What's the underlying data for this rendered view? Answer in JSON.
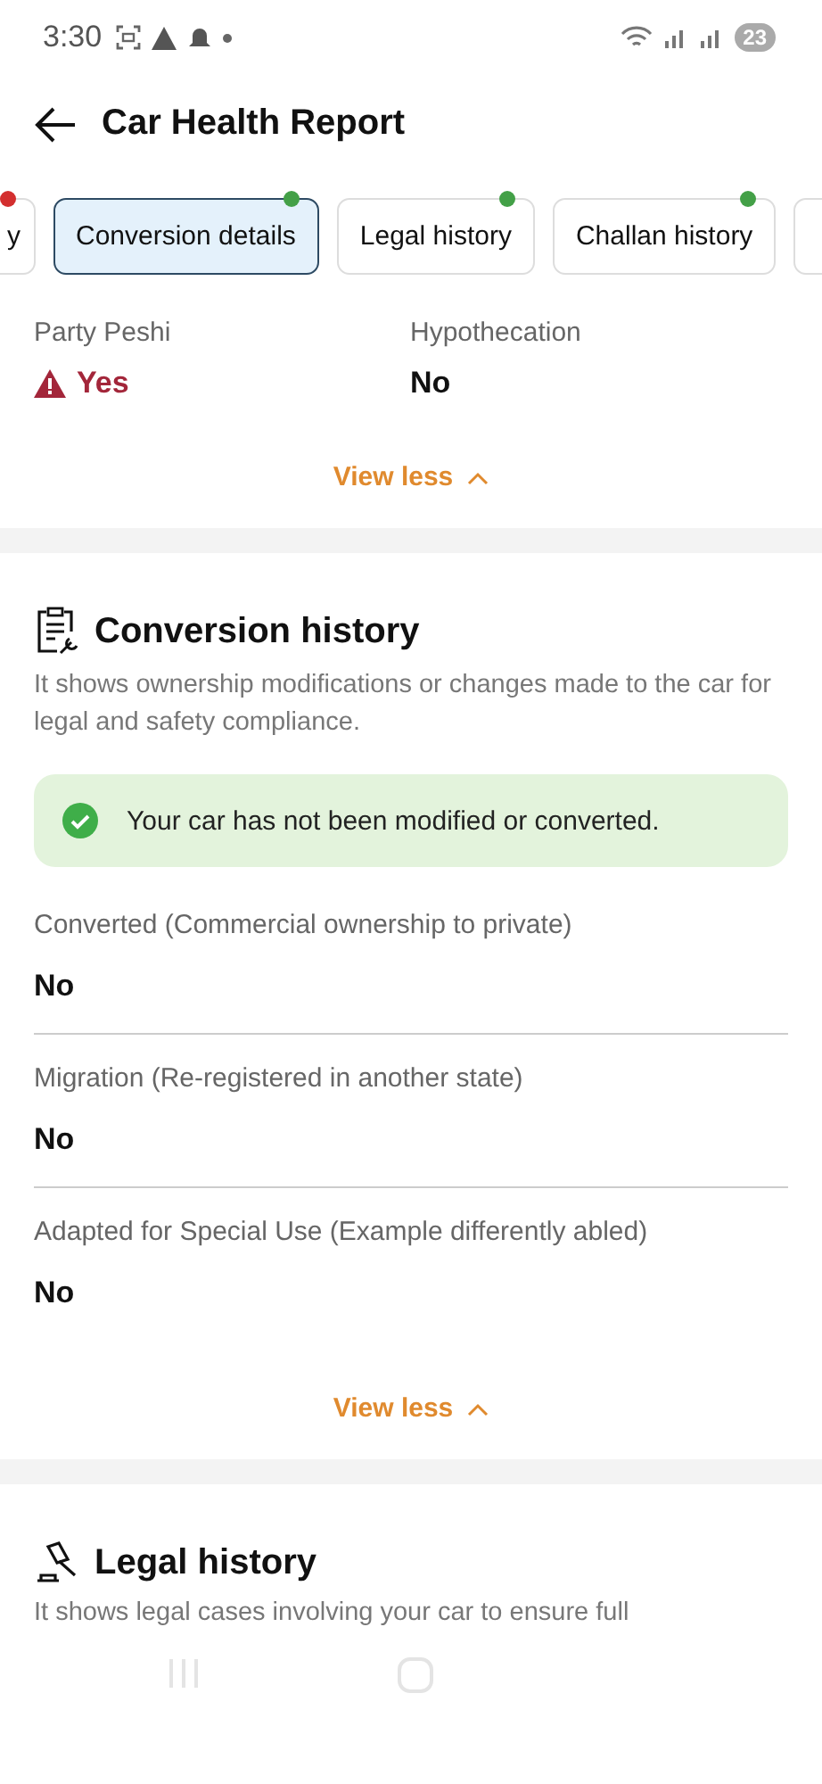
{
  "status_bar": {
    "time": "3:30",
    "battery": "23"
  },
  "header": {
    "title": "Car Health Report"
  },
  "tabs": [
    {
      "label": "y",
      "selected": false,
      "color": "#d32f2f"
    },
    {
      "label": "Conversion details",
      "selected": true,
      "color": "#43a047"
    },
    {
      "label": "Legal history",
      "selected": false,
      "color": "#43a047"
    },
    {
      "label": "Challan history",
      "selected": false,
      "color": "#43a047"
    }
  ],
  "top_card": {
    "fields": [
      {
        "label": "Party Peshi",
        "value": "Yes",
        "kind": "warning"
      },
      {
        "label": "Hypothecation",
        "value": "No",
        "kind": "plain"
      }
    ],
    "toggle": "View less"
  },
  "conversion_history": {
    "title": "Conversion history",
    "description": "It shows ownership modifications or changes made to the car for legal and safety compliance.",
    "notice": "Your car has not been modified or converted.",
    "items": [
      {
        "label": "Converted (Commercial ownership to private)",
        "value": "No"
      },
      {
        "label": "Migration (Re-registered in another state)",
        "value": "No"
      },
      {
        "label": "Adapted for Special Use (Example differently abled)",
        "value": "No"
      }
    ],
    "toggle": "View less"
  },
  "legal_history": {
    "title": "Legal history",
    "description": "It shows legal cases involving your car to ensure full"
  }
}
